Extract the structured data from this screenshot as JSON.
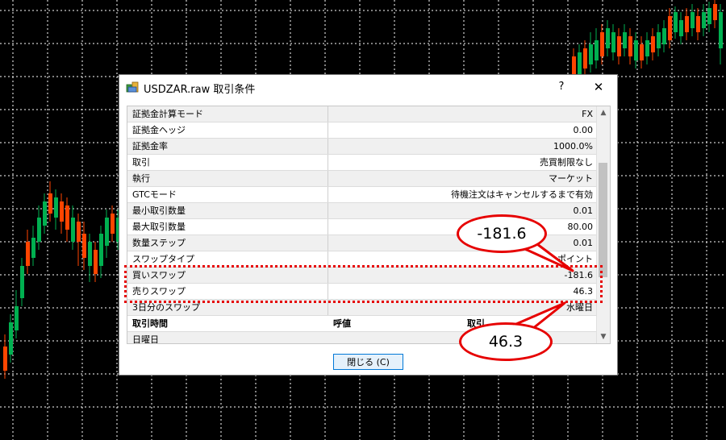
{
  "dialog": {
    "title": "USDZAR.raw 取引条件",
    "help_label": "?",
    "close_label": "✕",
    "close_button_label": "閉じる (C)"
  },
  "properties": [
    {
      "key": "証拠金計算モード",
      "value": "FX"
    },
    {
      "key": "証拠金ヘッジ",
      "value": "0.00"
    },
    {
      "key": "証拠金率",
      "value": "1000.0%"
    },
    {
      "key": "取引",
      "value": "売買制限なし"
    },
    {
      "key": "執行",
      "value": "マーケット"
    },
    {
      "key": "GTCモード",
      "value": "待機注文はキャンセルするまで有効"
    },
    {
      "key": "最小取引数量",
      "value": "0.01"
    },
    {
      "key": "最大取引数量",
      "value": "80.00"
    },
    {
      "key": "数量ステップ",
      "value": "0.01"
    },
    {
      "key": "スワップタイプ",
      "value": "ポイント"
    },
    {
      "key": "買いスワップ",
      "value": "-181.6"
    },
    {
      "key": "売りスワップ",
      "value": "46.3"
    },
    {
      "key": "3日分のスワップ",
      "value": "水曜日"
    }
  ],
  "session_header": {
    "col1": "取引時間",
    "col2": "呼値",
    "col3": "取引"
  },
  "session_first_row": "日曜日",
  "callouts": {
    "buy_swap": "-181.6",
    "sell_swap": "46.3"
  },
  "colors": {
    "chart_background": "#000000",
    "grid": "#ffffff",
    "bull_candle": "#00b050",
    "bear_candle": "#ff4500",
    "highlight": "#e60000"
  },
  "icons": {
    "app": "terminal-app-icon",
    "scroll_up": "scroll-up-arrow-icon",
    "scroll_down": "scroll-down-arrow-icon"
  }
}
